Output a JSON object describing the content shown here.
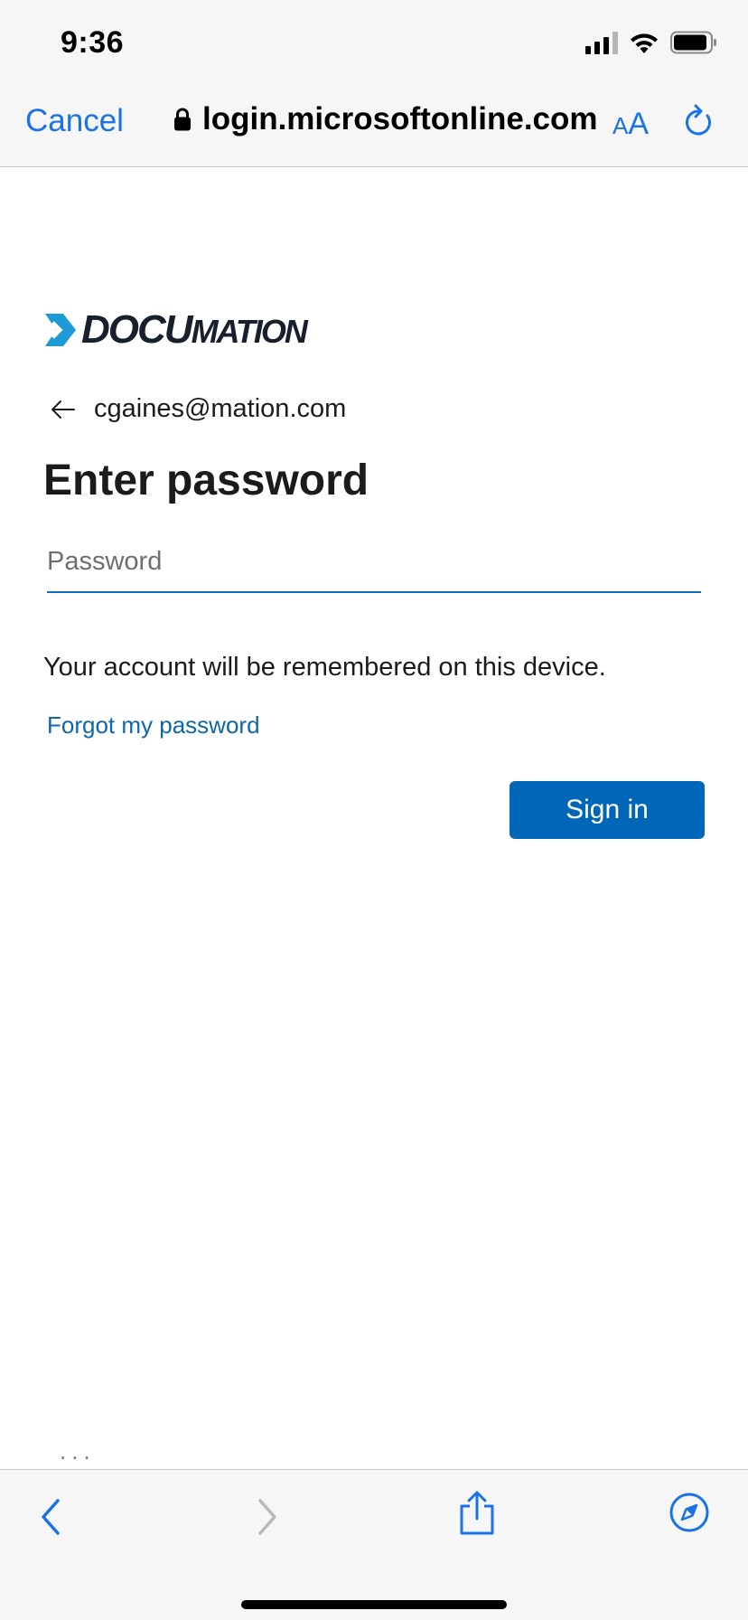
{
  "status_bar": {
    "time": "9:36",
    "icons": [
      "cellular-signal-icon",
      "wifi-icon",
      "battery-icon"
    ]
  },
  "browser": {
    "cancel_label": "Cancel",
    "url": "login.microsoftonline.com",
    "text_size_label_small": "A",
    "text_size_label_large": "A",
    "more_label": "...",
    "toolbar_icons": [
      "back-icon",
      "forward-icon",
      "share-icon",
      "compass-icon"
    ],
    "accent_color": "#1a72e8"
  },
  "page": {
    "logo_text_start": "DOCU",
    "logo_text_end": "MATION",
    "identity_email": "cgaines@mation.com",
    "title": "Enter password",
    "password_placeholder": "Password",
    "password_value": "",
    "remember_text": "Your account will be remembered on this device.",
    "forgot_link": "Forgot my password",
    "sign_in_label": "Sign in",
    "button_color": "#0067b8",
    "link_color": "#0f67a8"
  }
}
